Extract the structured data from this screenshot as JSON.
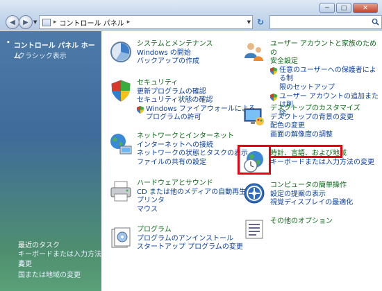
{
  "address": {
    "path_label": "コントロール パネル",
    "search_placeholder": ""
  },
  "window_buttons": {
    "minimize": "─",
    "maximize": "□",
    "close": "✕"
  },
  "sidebar": {
    "home_label": "コントロール パネル ホーム",
    "classic_label": "クラシック表示",
    "recent_title": "最近のタスク",
    "recent_items": [
      "キーボードまたは入力方法の",
      "変更",
      "国または地域の変更"
    ]
  },
  "categories": {
    "system": {
      "title": "システムとメンテナンス",
      "links": [
        "Windows の開始",
        "バックアップの作成"
      ]
    },
    "security": {
      "title": "セキュリティ",
      "links": [
        "更新プログラムの確認",
        "セキュリティ状態の確認",
        "Windows ファイアウォールによる",
        "プログラムの許可"
      ]
    },
    "network": {
      "title": "ネットワークとインターネット",
      "links": [
        "インターネットへの接続",
        "ネットワークの状態とタスクの表示",
        "ファイルの共有の設定"
      ]
    },
    "hardware": {
      "title": "ハードウェアとサウンド",
      "links": [
        "CD または他のメディアの自動再生",
        "プリンタ",
        "マウス"
      ]
    },
    "programs": {
      "title": "プログラム",
      "links": [
        "プログラムのアンインストール",
        "スタートアップ プログラムの変更"
      ]
    },
    "users": {
      "title": "ユーザー アカウントと家族のための",
      "title2": "安全設定",
      "links": [
        "任意のユーザーへの保護者による制",
        "限のセットアップ",
        "ユーザー アカウントの追加または削",
        "除"
      ]
    },
    "appearance": {
      "title": "デスクトップのカスタマイズ",
      "links": [
        "デスクトップの背景の変更",
        "配色の変更",
        "画面の解像度の調整"
      ]
    },
    "clock": {
      "title": "時計、言語、および地域",
      "links": [
        "キーボードまたは入力方法の変更"
      ]
    },
    "access": {
      "title": "コンピュータの簡単操作",
      "links": [
        "設定の提案の表示",
        "視覚ディスプレイの最適化"
      ]
    },
    "other": {
      "title": "その他のオプション"
    }
  }
}
